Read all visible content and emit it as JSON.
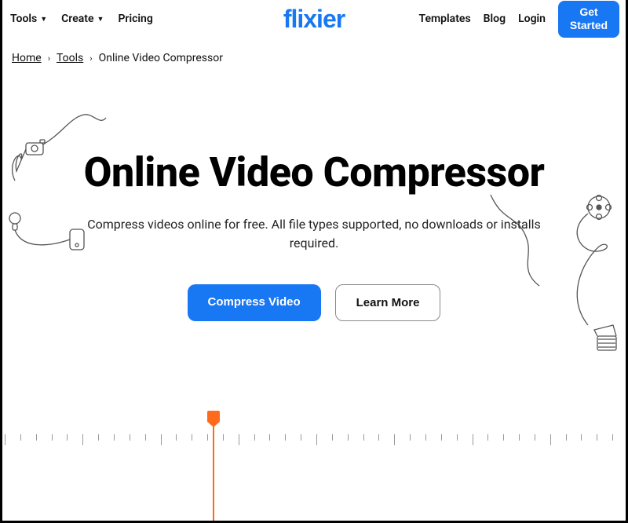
{
  "nav": {
    "left": [
      {
        "label": "Tools",
        "has_dropdown": true
      },
      {
        "label": "Create",
        "has_dropdown": true
      },
      {
        "label": "Pricing",
        "has_dropdown": false
      }
    ],
    "logo": "flixier",
    "right": [
      {
        "label": "Templates"
      },
      {
        "label": "Blog"
      },
      {
        "label": "Login"
      }
    ],
    "cta": "Get Started"
  },
  "breadcrumb": {
    "home": "Home",
    "tools": "Tools",
    "current": "Online Video Compressor"
  },
  "hero": {
    "title": "Online Video Compressor",
    "subtitle": "Compress videos online for free. All file types supported, no downloads or installs required.",
    "primary_cta": "Compress Video",
    "secondary_cta": "Learn More"
  }
}
